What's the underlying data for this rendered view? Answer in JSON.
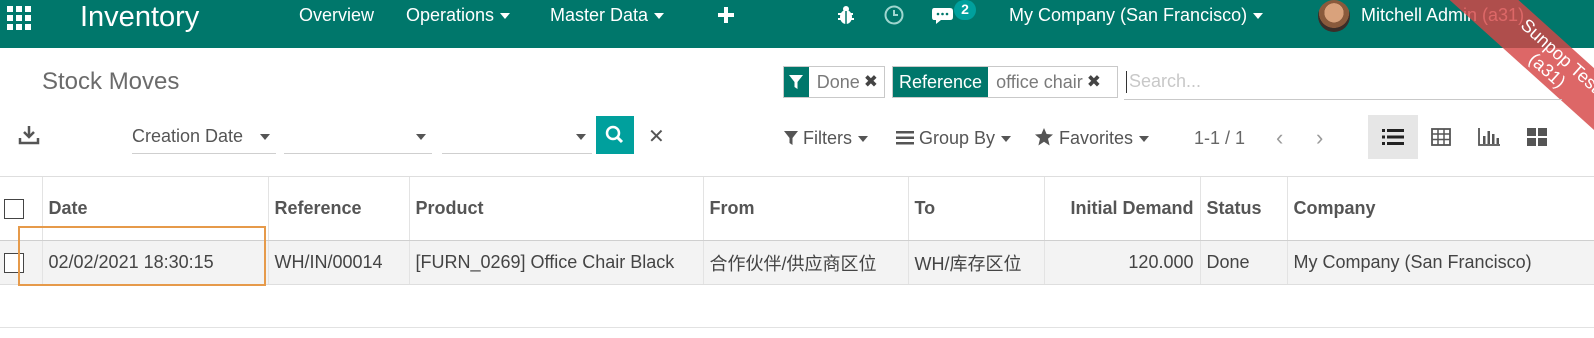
{
  "navbar": {
    "app_title": "Inventory",
    "menu": [
      {
        "label": "Overview",
        "has_dropdown": false
      },
      {
        "label": "Operations",
        "has_dropdown": true
      },
      {
        "label": "Master Data",
        "has_dropdown": true
      }
    ],
    "messages_count": "2",
    "company": "My Company (San Francisco)",
    "user": "Mitchell Admin (a31)",
    "colors": {
      "bar": "#00776b",
      "accent": "#00a09d"
    }
  },
  "ribbon": {
    "line1": "Sunpop Test",
    "line2": "(a31)"
  },
  "control_panel": {
    "title": "Stock Moves",
    "facets": [
      {
        "icon": "filter-icon",
        "value": "Done"
      },
      {
        "tag": "Reference",
        "value": "office chair"
      }
    ],
    "search_placeholder": "Search...",
    "date_field": "Creation Date",
    "date_from": "",
    "date_to": "",
    "filters_label": "Filters",
    "group_by_label": "Group By",
    "favorites_label": "Favorites",
    "pager": "1-1 / 1",
    "views": [
      "list-view-icon",
      "pivot-view-icon",
      "graph-view-icon",
      "kanban-view-icon"
    ],
    "active_view": "list"
  },
  "table": {
    "columns": [
      "Date",
      "Reference",
      "Product",
      "From",
      "To",
      "Initial Demand",
      "Status",
      "Company"
    ],
    "rows": [
      {
        "date": "02/02/2021 18:30:15",
        "reference": "WH/IN/00014",
        "product": "[FURN_0269] Office Chair Black",
        "from": "合作伙伴/供应商区位",
        "to": "WH/库存区位",
        "initial_demand": "120.000",
        "status": "Done",
        "company": "My Company (San Francisco)"
      }
    ]
  },
  "colors": {
    "highlight_box": "#e69a4a"
  }
}
